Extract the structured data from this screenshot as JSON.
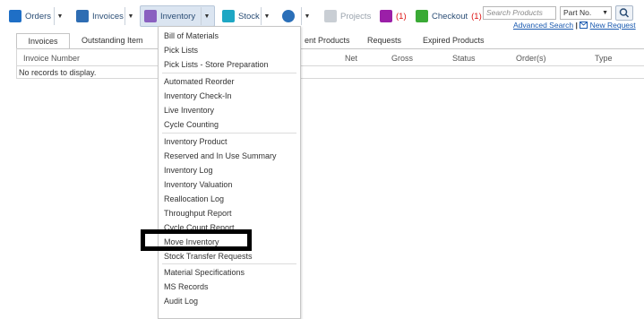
{
  "toolbar": {
    "orders": "Orders",
    "invoices": "Invoices",
    "inventory": "Inventory",
    "stock": "Stock",
    "projects": "Projects",
    "cart_count": "(1)",
    "checkout": "Checkout",
    "checkout_count": "(1)",
    "search_placeholder": "Search Products",
    "search_field": "Part No.",
    "advanced_search": "Advanced Search",
    "new_request": "New Request"
  },
  "tabs": [
    "Invoices",
    "Outstanding Item",
    "ent Products",
    "Requests",
    "Expired Products"
  ],
  "grid": {
    "columns": [
      "Invoice Number",
      "Net",
      "Gross",
      "Status",
      "Order(s)",
      "Type"
    ],
    "empty_text": "No records to display."
  },
  "menu": {
    "items": [
      "Bill of Materials",
      "Pick Lists",
      "Pick Lists - Store Preparation",
      "Automated Reorder",
      "Inventory Check-In",
      "Live Inventory",
      "Cycle Counting",
      "Inventory Product",
      "Reserved and In Use Summary",
      "Inventory Log",
      "Inventory Valuation",
      "Reallocation Log",
      "Throughput Report",
      "Cycle Count Report",
      "Move Inventory",
      "Stock Transfer Requests",
      "Material Specifications",
      "MS Records",
      "Audit Log"
    ]
  },
  "colors": {
    "accent": "#2a4d75",
    "link": "#1a5ab0",
    "cart": "#9b1fa8",
    "checkout_icon": "#3aaa35",
    "highlight_box": "#000000"
  },
  "icons": [
    "orders-icon",
    "invoices-icon",
    "inventory-icon",
    "stock-icon",
    "settings-gear-icon",
    "projects-tag-icon",
    "cart-icon",
    "checkout-icon",
    "search-icon",
    "mail-icon"
  ]
}
